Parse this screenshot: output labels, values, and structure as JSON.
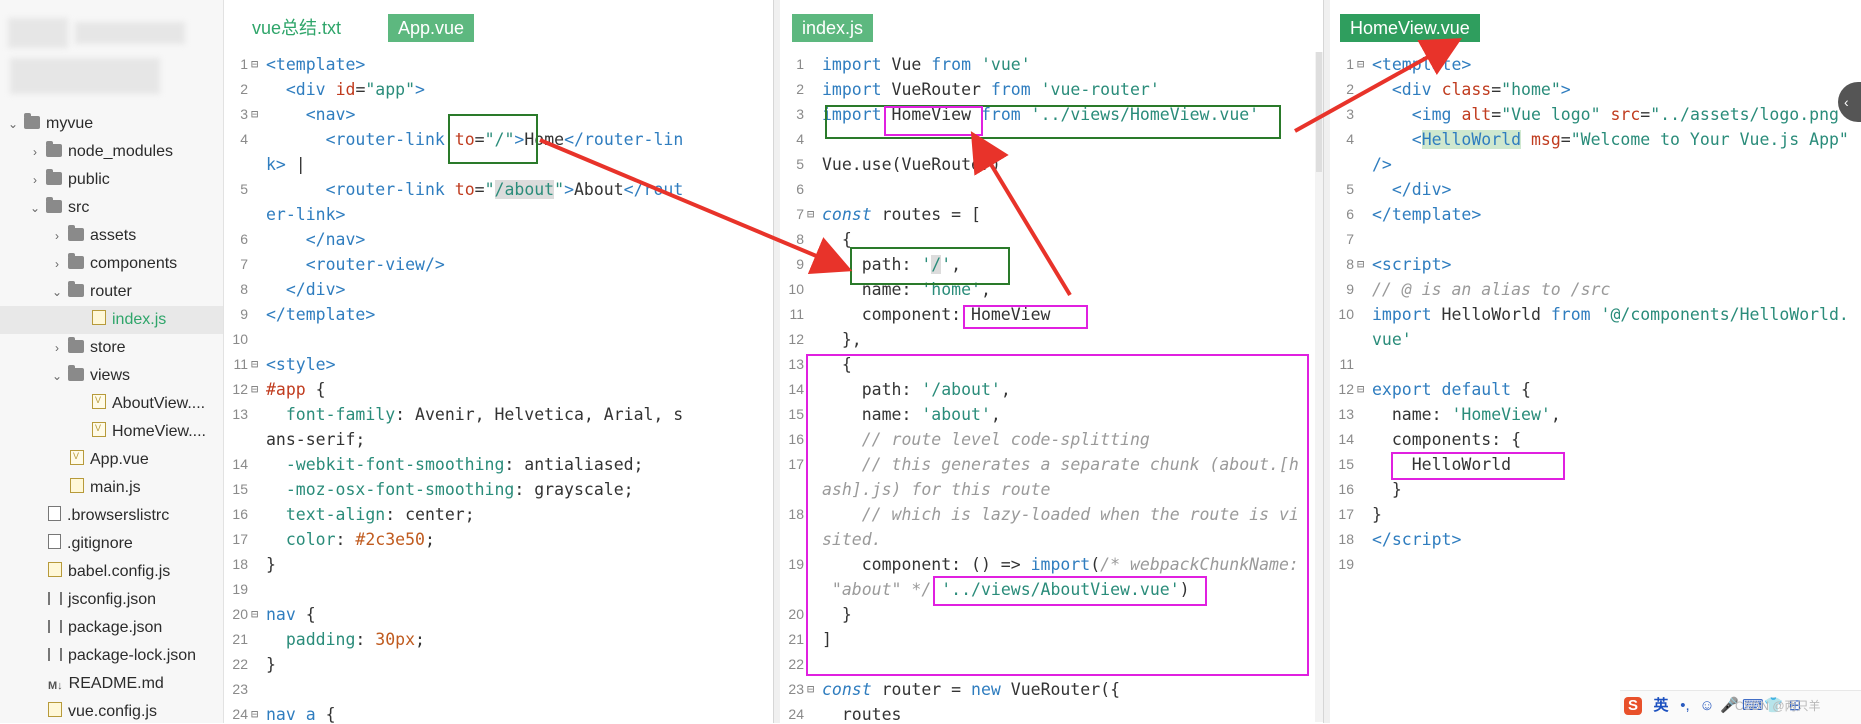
{
  "sidebar": {
    "items": [
      {
        "label": "myvue",
        "depth": 0,
        "chevron": "open",
        "icon": "folder-icon"
      },
      {
        "label": "node_modules",
        "depth": 1,
        "chevron": "closed",
        "icon": "folder-icon"
      },
      {
        "label": "public",
        "depth": 1,
        "chevron": "closed",
        "icon": "folder-icon"
      },
      {
        "label": "src",
        "depth": 1,
        "chevron": "open",
        "icon": "folder-icon"
      },
      {
        "label": "assets",
        "depth": 2,
        "chevron": "closed",
        "icon": "folder-icon"
      },
      {
        "label": "components",
        "depth": 2,
        "chevron": "closed",
        "icon": "folder-icon"
      },
      {
        "label": "router",
        "depth": 2,
        "chevron": "open",
        "icon": "folder-icon"
      },
      {
        "label": "index.js",
        "depth": 3,
        "chevron": "none",
        "icon": "js-file-icon",
        "selected": true
      },
      {
        "label": "store",
        "depth": 2,
        "chevron": "closed",
        "icon": "folder-icon"
      },
      {
        "label": "views",
        "depth": 2,
        "chevron": "open",
        "icon": "folder-icon"
      },
      {
        "label": "AboutView....",
        "depth": 3,
        "chevron": "none",
        "icon": "vue-file-icon"
      },
      {
        "label": "HomeView....",
        "depth": 3,
        "chevron": "none",
        "icon": "vue-file-icon"
      },
      {
        "label": "App.vue",
        "depth": 2,
        "chevron": "none",
        "icon": "vue-file-icon"
      },
      {
        "label": "main.js",
        "depth": 2,
        "chevron": "none",
        "icon": "js-file-icon"
      },
      {
        "label": ".browserslistrc",
        "depth": 1,
        "chevron": "none",
        "icon": "file-icon"
      },
      {
        "label": ".gitignore",
        "depth": 1,
        "chevron": "none",
        "icon": "file-icon"
      },
      {
        "label": "babel.config.js",
        "depth": 1,
        "chevron": "none",
        "icon": "js-file-icon"
      },
      {
        "label": "jsconfig.json",
        "depth": 1,
        "chevron": "none",
        "icon": "json-file-icon"
      },
      {
        "label": "package.json",
        "depth": 1,
        "chevron": "none",
        "icon": "json-file-icon"
      },
      {
        "label": "package-lock.json",
        "depth": 1,
        "chevron": "none",
        "icon": "json-file-icon"
      },
      {
        "label": "README.md",
        "depth": 1,
        "chevron": "none",
        "icon": "markdown-file-icon",
        "icon_text": "M↓"
      },
      {
        "label": "vue.config.js",
        "depth": 1,
        "chevron": "none",
        "icon": "js-file-icon"
      }
    ]
  },
  "panes": [
    {
      "tabs": [
        {
          "label": "vue总结.txt",
          "active": false
        },
        {
          "label": "App.vue",
          "active": true
        }
      ],
      "lines": [
        {
          "n": "1",
          "fold": "⊟",
          "html": "<span class='tag'>&lt;template&gt;</span>"
        },
        {
          "n": "2",
          "html": "  <span class='tag'>&lt;div</span> <span class='attr'>id</span>=<span class='str'>\"app\"</span><span class='tag'>&gt;</span>"
        },
        {
          "n": "3",
          "fold": "⊟",
          "html": "    <span class='tag'>&lt;nav&gt;</span>"
        },
        {
          "n": "4",
          "html": "      <span class='tag'>&lt;router-link</span> <span class='attr'>to</span>=<span class='str'>\"/\"</span><span class='tag'>&gt;</span>Home<span class='tag'>&lt;/router-lin</span>"
        },
        {
          "n": "",
          "html": "<span class='tag'>k&gt;</span> |"
        },
        {
          "n": "5",
          "html": "      <span class='tag'>&lt;router-link</span> <span class='attr'>to</span>=<span class='str'>\"<span class='hl'>/about</span>\"</span><span class='tag'>&gt;</span>About<span class='tag'>&lt;/rout</span>"
        },
        {
          "n": "",
          "html": "<span class='tag'>er-link&gt;</span>"
        },
        {
          "n": "6",
          "html": "    <span class='tag'>&lt;/nav&gt;</span>"
        },
        {
          "n": "7",
          "html": "    <span class='tag'>&lt;router-view/&gt;</span>"
        },
        {
          "n": "8",
          "html": "  <span class='tag'>&lt;/div&gt;</span>"
        },
        {
          "n": "9",
          "html": "<span class='tag'>&lt;/template&gt;</span>"
        },
        {
          "n": "10",
          "html": ""
        },
        {
          "n": "11",
          "fold": "⊟",
          "html": "<span class='tag'>&lt;style&gt;</span>"
        },
        {
          "n": "12",
          "fold": "⊟",
          "html": "<span class='col-red'>#app</span> {"
        },
        {
          "n": "13",
          "html": "  <span class='prop'>font-family</span>: Avenir, Helvetica, Arial, s"
        },
        {
          "n": "",
          "html": "ans-serif;"
        },
        {
          "n": "14",
          "html": "  <span class='prop'>-webkit-font-smoothing</span>: antialiased;"
        },
        {
          "n": "15",
          "html": "  <span class='prop'>-moz-osx-font-smoothing</span>: grayscale;"
        },
        {
          "n": "16",
          "html": "  <span class='prop'>text-align</span>: center;"
        },
        {
          "n": "17",
          "html": "  <span class='prop'>color</span>: <span class='num'>#2c3e50</span>;"
        },
        {
          "n": "18",
          "html": "}"
        },
        {
          "n": "19",
          "html": ""
        },
        {
          "n": "20",
          "fold": "⊟",
          "html": "<span class='kw'>nav</span> {"
        },
        {
          "n": "21",
          "html": "  <span class='prop'>padding</span>: <span class='num'>30px</span>;"
        },
        {
          "n": "22",
          "html": "}"
        },
        {
          "n": "23",
          "html": ""
        },
        {
          "n": "24",
          "fold": "⊟",
          "html": "<span class='kw'>nav a</span> {"
        }
      ]
    },
    {
      "tabs": [
        {
          "label": "index.js",
          "active": true
        }
      ],
      "lines": [
        {
          "n": "1",
          "html": "<span class='kw'>import</span> Vue <span class='kw'>from</span> <span class='str'>'vue'</span>"
        },
        {
          "n": "2",
          "html": "<span class='kw'>import</span> VueRouter <span class='kw'>from</span> <span class='str'>'vue-router'</span>"
        },
        {
          "n": "3",
          "html": "<span class='kw'>import</span> HomeView <span class='kw'>from</span> <span class='str'>'../views/HomeView.vue'</span>"
        },
        {
          "n": "4",
          "html": ""
        },
        {
          "n": "5",
          "html": "Vue.use(VueRouter)"
        },
        {
          "n": "6",
          "html": ""
        },
        {
          "n": "7",
          "fold": "⊟",
          "html": "<span class='kw' style='font-style:italic'>const</span> routes = ["
        },
        {
          "n": "8",
          "html": "  {"
        },
        {
          "n": "9",
          "html": "    path: <span class='str'>'<span class='hl'>/</span>'</span>,"
        },
        {
          "n": "10",
          "html": "    name: <span class='str'>'home'</span>,"
        },
        {
          "n": "11",
          "html": "    component: HomeView"
        },
        {
          "n": "12",
          "html": "  },"
        },
        {
          "n": "13",
          "html": "  {"
        },
        {
          "n": "14",
          "html": "    path: <span class='str'>'/about'</span>,"
        },
        {
          "n": "15",
          "html": "    name: <span class='str'>'about'</span>,"
        },
        {
          "n": "16",
          "html": "    <span class='com'>// route level code-splitting</span>"
        },
        {
          "n": "17",
          "html": "    <span class='com'>// this generates a separate chunk (about.[h</span>"
        },
        {
          "n": "",
          "html": "<span class='com'>ash].js) for this route</span>"
        },
        {
          "n": "18",
          "html": "    <span class='com'>// which is lazy-loaded when the route is vi</span>"
        },
        {
          "n": "",
          "html": "<span class='com'>sited.</span>"
        },
        {
          "n": "19",
          "html": "    component: () =&gt; <span class='kw'>import</span>(<span class='com'>/* webpackChunkName:</span>"
        },
        {
          "n": "",
          "html": "<span class='com'> \"about\" */</span> <span class='str'>'../views/AboutView.vue'</span>)"
        },
        {
          "n": "20",
          "html": "  }"
        },
        {
          "n": "21",
          "html": "]"
        },
        {
          "n": "22",
          "html": ""
        },
        {
          "n": "23",
          "fold": "⊟",
          "html": "<span class='kw' style='font-style:italic'>const</span> router = <span class='kw'>new</span> VueRouter({"
        },
        {
          "n": "24",
          "html": "  routes"
        }
      ]
    },
    {
      "tabs": [
        {
          "label": "HomeView.vue",
          "active": true
        }
      ],
      "lines": [
        {
          "n": "1",
          "fold": "⊟",
          "html": "<span class='tag'>&lt;template&gt;</span>"
        },
        {
          "n": "2",
          "html": "  <span class='tag'>&lt;div</span> <span class='attr'>class</span>=<span class='str'>\"home\"</span><span class='tag'>&gt;</span>"
        },
        {
          "n": "3",
          "html": "    <span class='tag'>&lt;img</span> <span class='attr'>alt</span>=<span class='str'>\"Vue logo\"</span> <span class='attr'>src</span>=<span class='str'>\"../assets/logo.png</span>"
        },
        {
          "n": "4",
          "html": "    <span class='tag'>&lt;<span class='hl-green'>HelloWorld</span></span> <span class='attr'>msg</span>=<span class='str'>\"Welcome to Your Vue.js App\"</span>"
        },
        {
          "n": "",
          "html": "<span class='tag'>/&gt;</span>"
        },
        {
          "n": "5",
          "html": "  <span class='tag'>&lt;/div&gt;</span>"
        },
        {
          "n": "6",
          "html": "<span class='tag'>&lt;/template&gt;</span>"
        },
        {
          "n": "7",
          "html": ""
        },
        {
          "n": "8",
          "fold": "⊟",
          "html": "<span class='tag'>&lt;script&gt;</span>"
        },
        {
          "n": "9",
          "html": "<span class='com'>// @ is an alias to /src</span>"
        },
        {
          "n": "10",
          "html": "<span class='kw'>import</span> HelloWorld <span class='kw'>from</span> <span class='str'>'@/components/HelloWorld.</span>"
        },
        {
          "n": "",
          "html": "<span class='str'>vue'</span>"
        },
        {
          "n": "11",
          "html": ""
        },
        {
          "n": "12",
          "fold": "⊟",
          "html": "<span class='kw'>export default</span> {"
        },
        {
          "n": "13",
          "html": "  name: <span class='str'>'HomeView'</span>,"
        },
        {
          "n": "14",
          "html": "  components: {"
        },
        {
          "n": "15",
          "html": "    HelloWorld"
        },
        {
          "n": "16",
          "html": "  }"
        },
        {
          "n": "17",
          "html": "}"
        },
        {
          "n": "18",
          "html": "<span class='tag'>&lt;/script&gt;</span>"
        },
        {
          "n": "19",
          "html": ""
        }
      ]
    }
  ],
  "ime_bar": {
    "logo": "S",
    "lang": "英",
    "icons": [
      "•,",
      "☺",
      "🎤",
      "⌨",
      "👕",
      "⊞"
    ]
  },
  "watermark": "CSDN @两只羊",
  "side_handle": "‹",
  "colors": {
    "tab_active": "#5db87f",
    "annotation_green": "#2a7a2a",
    "annotation_magenta": "#e020e0",
    "arrow_red": "#e8332a"
  }
}
